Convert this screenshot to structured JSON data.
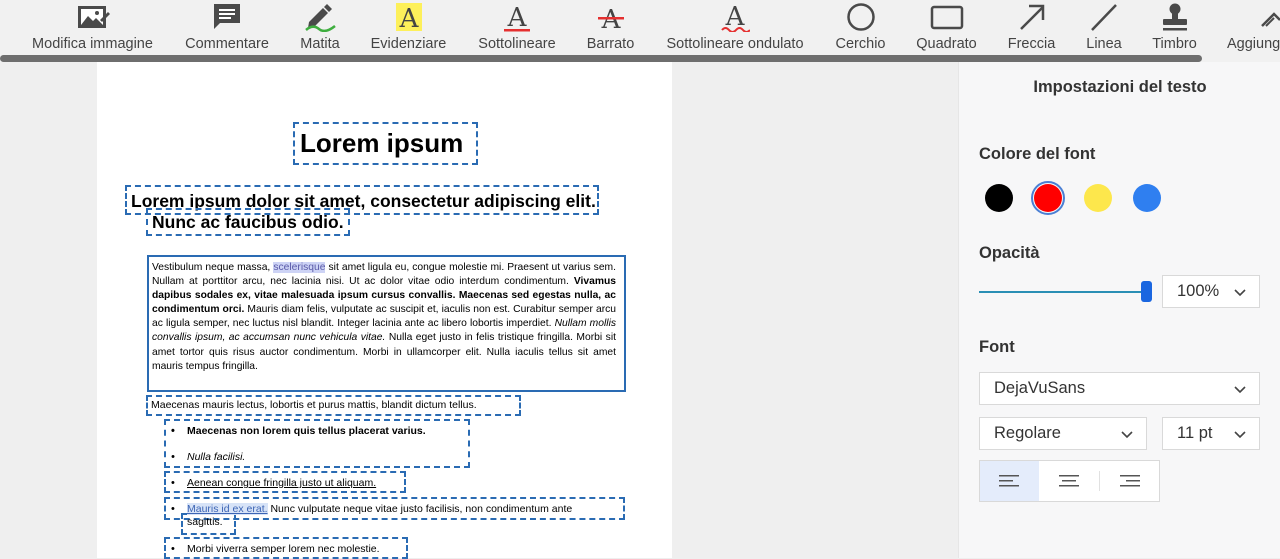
{
  "toolbar": {
    "tools": [
      {
        "label": "Modifica immagine",
        "icon": "image-edit-icon"
      },
      {
        "label": "Commentare",
        "icon": "comment-icon"
      },
      {
        "label": "Matita",
        "icon": "pencil-icon"
      },
      {
        "label": "Evidenziare",
        "icon": "highlight-icon"
      },
      {
        "label": "Sottolineare",
        "icon": "underline-icon"
      },
      {
        "label": "Barrato",
        "icon": "strikethrough-icon"
      },
      {
        "label": "Sottolineare ondulato",
        "icon": "wavy-underline-icon"
      },
      {
        "label": "Cerchio",
        "icon": "circle-icon"
      },
      {
        "label": "Quadrato",
        "icon": "square-icon"
      },
      {
        "label": "Freccia",
        "icon": "arrow-icon"
      },
      {
        "label": "Linea",
        "icon": "line-icon"
      },
      {
        "label": "Timbro",
        "icon": "stamp-icon"
      },
      {
        "label": "Aggiung",
        "icon": "add-signature-icon"
      }
    ]
  },
  "document": {
    "title": "Lorem ipsum",
    "heading_line1": "Lorem ipsum dolor sit amet, consectetur adipiscing elit.",
    "heading_line2": "Nunc ac faucibus odio.",
    "paragraph": {
      "p1": "Vestibulum neque massa, ",
      "highlight": "scelerisque",
      "p2": " sit amet ligula eu, congue molestie mi. Praesent ut varius sem. Nullam at porttitor arcu, nec lacinia nisi. Ut ac dolor vitae odio interdum condimentum. ",
      "bold": "Vivamus dapibus sodales ex, vitae malesuada ipsum cursus convallis. Maecenas sed egestas nulla, ac condimentum orci.",
      "p3": " Mauris diam felis, vulputate ac suscipit et, iaculis non est. Curabitur semper arcu ac ligula semper, nec luctus nisl blandit. Integer lacinia ante ac libero lobortis imperdiet. ",
      "italic": "Nullam mollis convallis ipsum, ac accumsan nunc vehicula vitae.",
      "p4": " Nulla eget justo in felis tristique fringilla. Morbi sit amet tortor quis risus auctor condimentum. Morbi in ullamcorper elit. Nulla iaculis tellus sit amet mauris tempus fringilla."
    },
    "line_after": "Maecenas mauris lectus, lobortis et purus mattis, blandit dictum tellus.",
    "bullets": {
      "b1": "Maecenas non lorem quis tellus placerat varius.",
      "b2": "Nulla facilisi.",
      "b3": "Aenean congue fringilla justo ut aliquam.",
      "b4_highlight": "Mauris id ex erat.",
      "b4_rest": " Nunc vulputate neque vitae justo facilisis, non condimentum ante",
      "b4_wrap": "sagittis.",
      "b5": "Morbi viverra semper lorem nec molestie."
    }
  },
  "panel": {
    "title": "Impostazioni del testo",
    "font_color_label": "Colore del font",
    "colors": [
      "#000000",
      "#ff0000",
      "#fde74c",
      "#2f7ff0"
    ],
    "selected_color": "#ff0000",
    "opacity_label": "Opacità",
    "opacity_value": "100%",
    "opacity_level": 1.0,
    "font_label": "Font",
    "font_family": "DejaVuSans",
    "font_style": "Regolare",
    "font_size": "11 pt",
    "alignment": "left"
  }
}
